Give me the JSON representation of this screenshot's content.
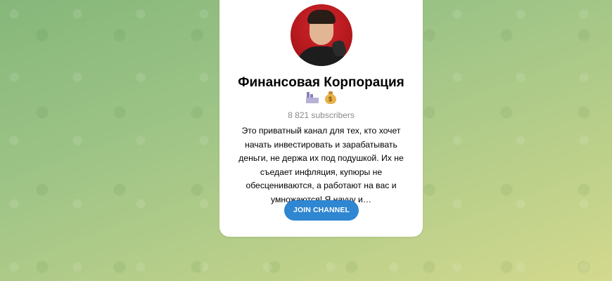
{
  "channel": {
    "title": "Финансовая Корпорация",
    "emojis": [
      "factory-icon",
      "moneybag-icon"
    ],
    "moneybag_sign": "$",
    "subscribers": "8 821 subscribers",
    "description": "Это приватный канал для тех, кто хочет начать инвестировать и зарабатывать деньги, не держа их под подушкой. Их не съедает инфляция, купюры не обесцениваются, а работают на вас и умножаются! Я научу и…"
  },
  "actions": {
    "join_label": "JOIN CHANNEL"
  },
  "colors": {
    "accent": "#2f86d1",
    "avatar_bg": "#c41e24",
    "background_start": "#86b77a",
    "background_end": "#d3d98d"
  }
}
